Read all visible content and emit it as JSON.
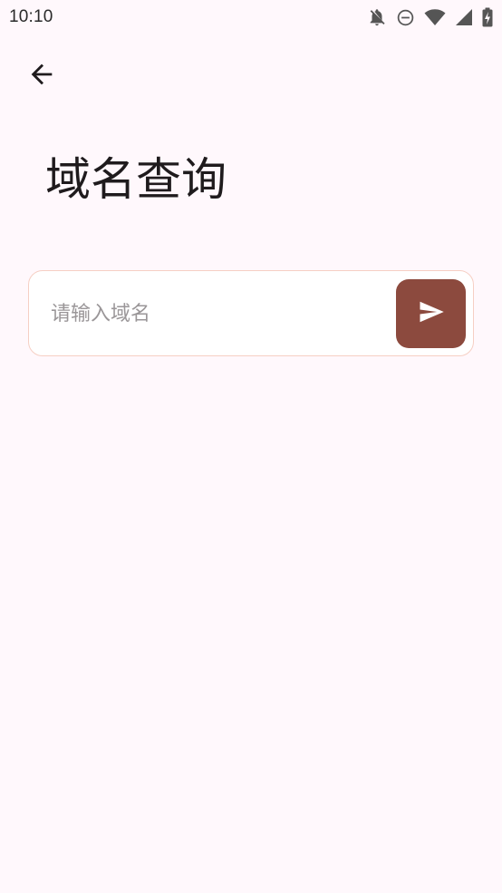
{
  "status_bar": {
    "time": "10:10",
    "icons": [
      "notifications-off-icon",
      "do-not-disturb-icon",
      "wifi-icon",
      "signal-icon",
      "battery-charging-icon"
    ]
  },
  "header": {
    "back_icon": "arrow-back-icon"
  },
  "page": {
    "title": "域名查询"
  },
  "search": {
    "value": "",
    "placeholder": "请输入域名",
    "send_icon": "send-icon"
  },
  "colors": {
    "background": "#FFF8FC",
    "accent": "#8C4A3E",
    "card_border": "#F6CFC4",
    "title_text": "#1F1B1D",
    "placeholder_text": "#9A9698"
  }
}
